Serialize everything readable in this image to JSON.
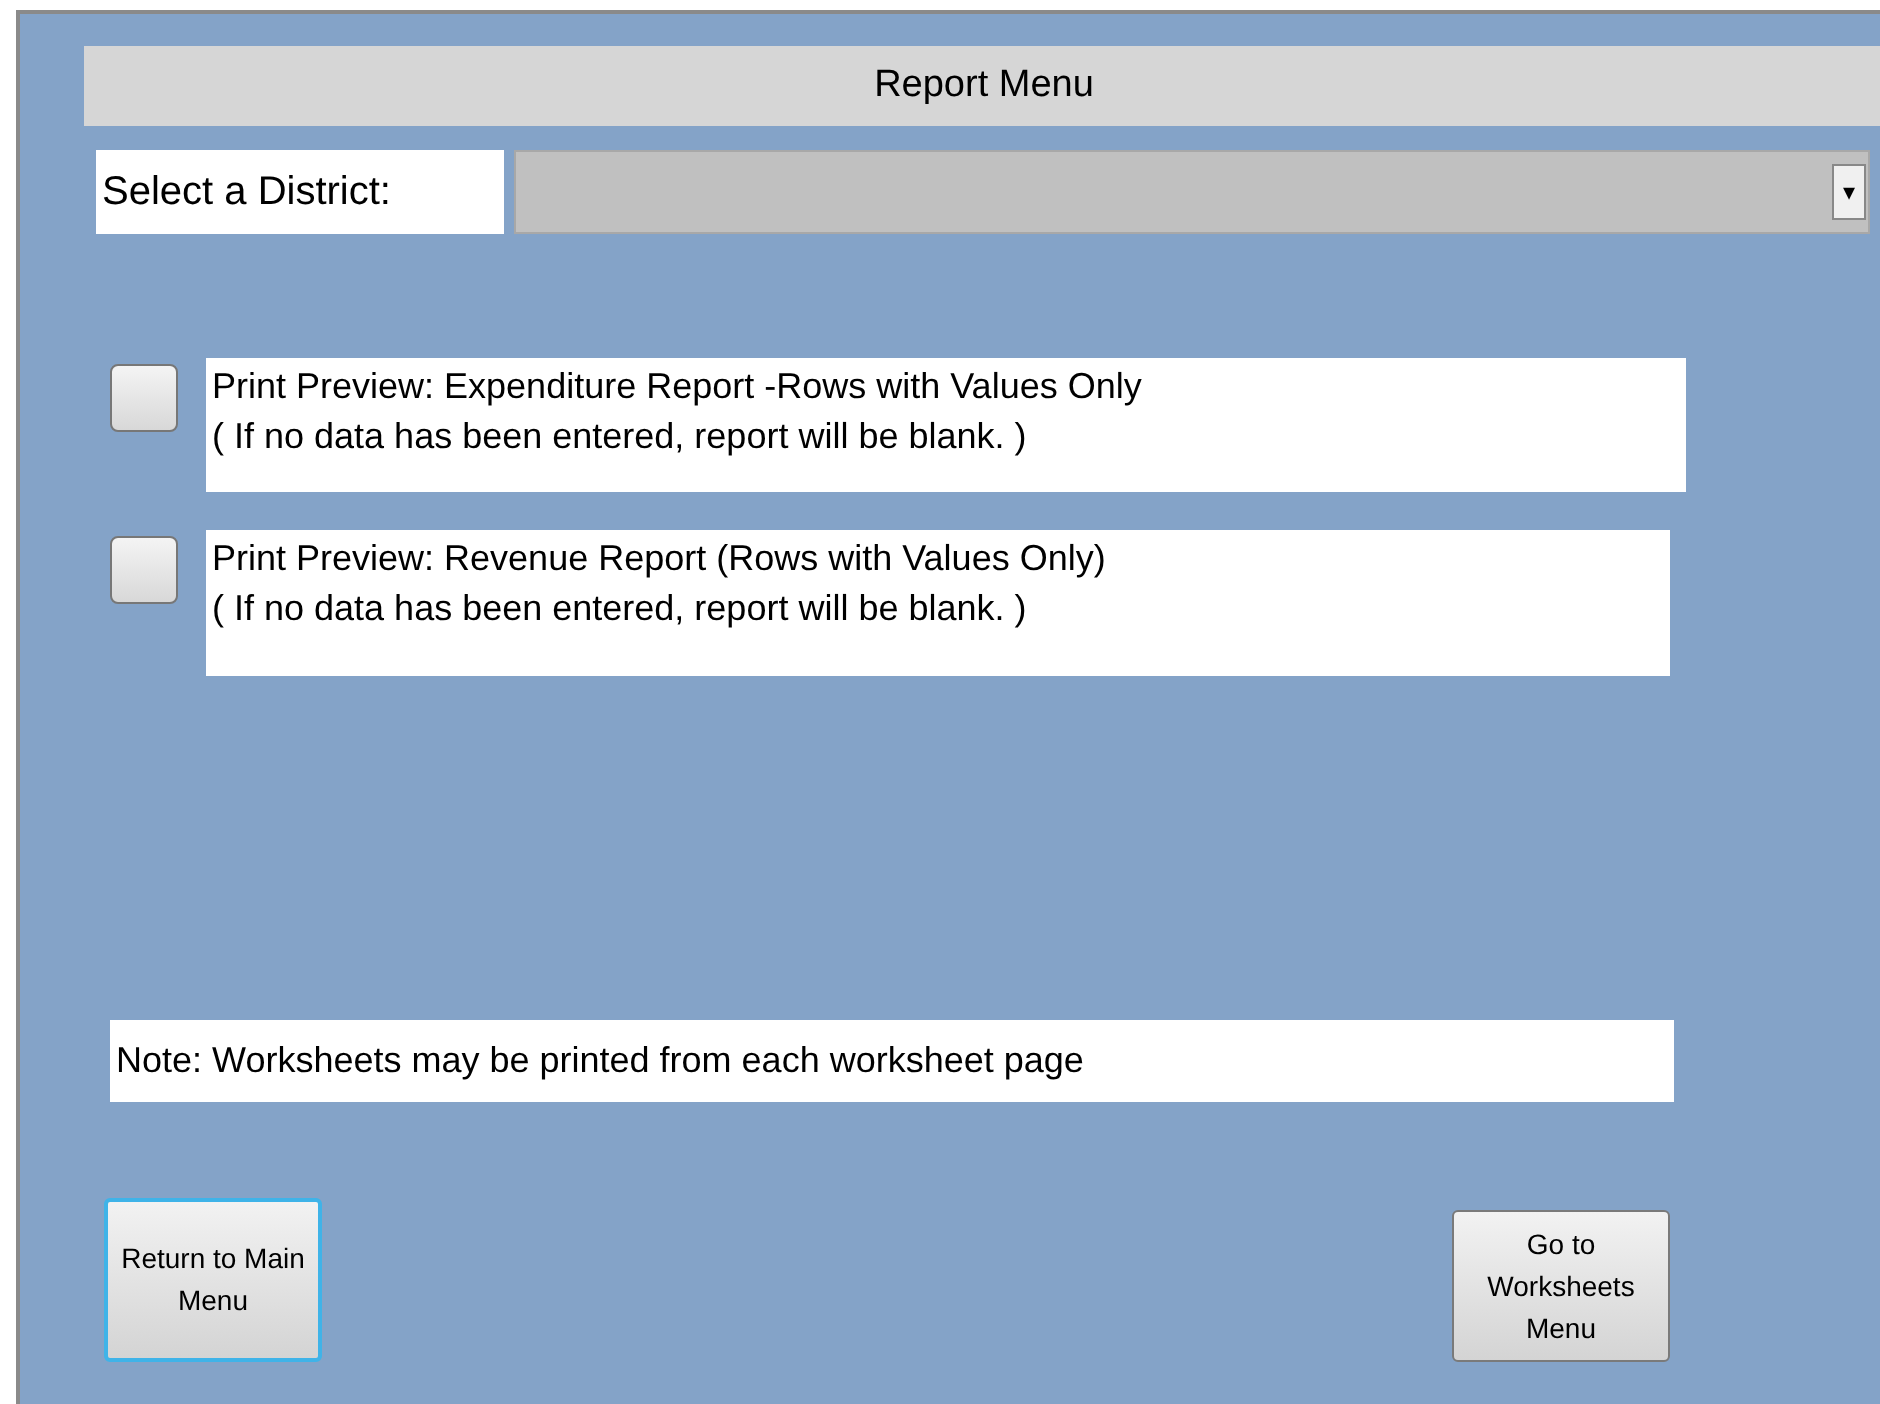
{
  "header": {
    "title": "Report Menu"
  },
  "district": {
    "label": "Select a District:",
    "arrow": "▾"
  },
  "reports": [
    {
      "checked": false,
      "title": "Print Preview: Expenditure Report -Rows with Values Only",
      "note": "( If no data has been entered, report will be blank. )"
    },
    {
      "checked": false,
      "title": "Print Preview: Revenue Report (Rows with Values Only)",
      "note": "( If no data has been entered, report will be blank. )"
    }
  ],
  "note": "Note:  Worksheets may be printed from each worksheet page",
  "buttons": [
    {
      "label": "Return to Main Menu",
      "focused": true
    },
    {
      "label": "Go to Worksheets Menu",
      "focused": false
    }
  ]
}
